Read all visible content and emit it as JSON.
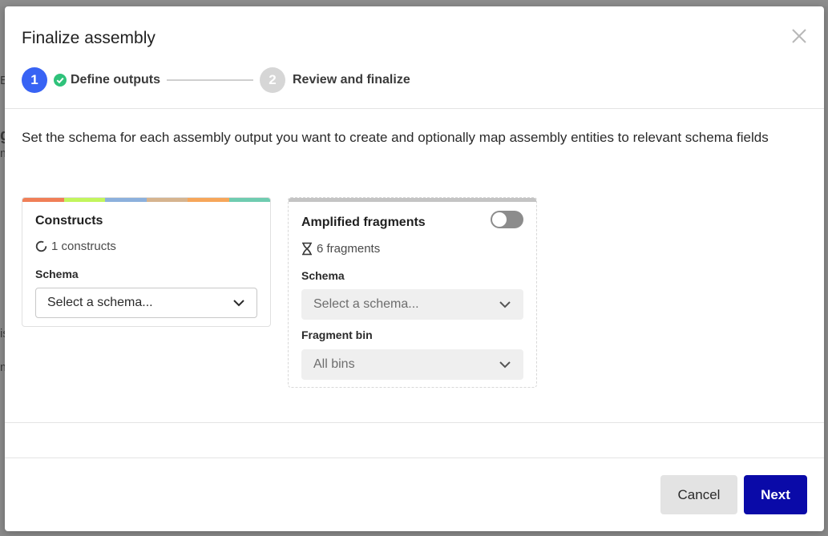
{
  "modal": {
    "title": "Finalize assembly",
    "close_icon": "close-icon"
  },
  "stepper": {
    "steps": [
      {
        "number": "1",
        "label": "Define outputs",
        "state": "active",
        "complete_icon": "check-circle-icon"
      },
      {
        "number": "2",
        "label": "Review and finalize",
        "state": "inactive"
      }
    ]
  },
  "description": "Set the schema for each assembly output you want to create and optionally map assembly entities to relevant schema fields",
  "cards": {
    "constructs": {
      "title": "Constructs",
      "count_text": "1 constructs",
      "icon": "circular-plasmid-icon",
      "schema_label": "Schema",
      "schema_placeholder": "Select a schema...",
      "colorbar": [
        "#f07f57",
        "#c2f55d",
        "#8cb0dc",
        "#d6b48f",
        "#f6a65a",
        "#6fccb0"
      ]
    },
    "fragments": {
      "title": "Amplified fragments",
      "count_text": "6 fragments",
      "icon": "dna-helix-icon",
      "toggle_on": false,
      "schema_label": "Schema",
      "schema_placeholder": "Select a schema...",
      "bin_label": "Fragment bin",
      "bin_value": "All bins"
    }
  },
  "footer": {
    "cancel_label": "Cancel",
    "next_label": "Next"
  },
  "colors": {
    "accent": "#3863f4",
    "primary_button": "#0a0aa8",
    "success": "#2fc27a"
  }
}
